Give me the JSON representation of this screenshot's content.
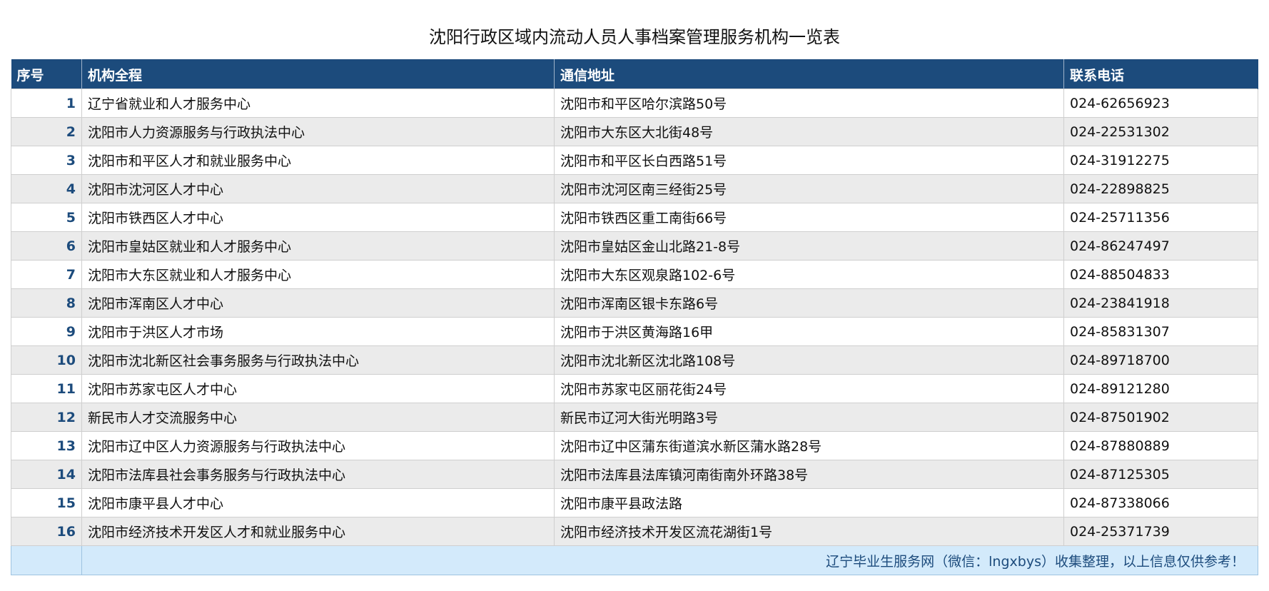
{
  "title": "沈阳行政区域内流动人员人事档案管理服务机构一览表",
  "table": {
    "headers": [
      "序号",
      "机构全程",
      "通信地址",
      "联系电话"
    ],
    "rows": [
      {
        "no": "1",
        "name": "辽宁省就业和人才服务中心",
        "address": "沈阳市和平区哈尔滨路50号",
        "phone": "024-62656923"
      },
      {
        "no": "2",
        "name": "沈阳市人力资源服务与行政执法中心",
        "address": "沈阳市大东区大北街48号",
        "phone": "024-22531302"
      },
      {
        "no": "3",
        "name": "沈阳市和平区人才和就业服务中心",
        "address": "沈阳市和平区长白西路51号",
        "phone": "024-31912275"
      },
      {
        "no": "4",
        "name": "沈阳市沈河区人才中心",
        "address": "沈阳市沈河区南三经街25号",
        "phone": "024-22898825"
      },
      {
        "no": "5",
        "name": "沈阳市铁西区人才中心",
        "address": "沈阳市铁西区重工南街66号",
        "phone": "024-25711356"
      },
      {
        "no": "6",
        "name": "沈阳市皇姑区就业和人才服务中心",
        "address": "沈阳市皇姑区金山北路21-8号",
        "phone": "024-86247497"
      },
      {
        "no": "7",
        "name": "沈阳市大东区就业和人才服务中心",
        "address": "沈阳市大东区观泉路102-6号",
        "phone": "024-88504833"
      },
      {
        "no": "8",
        "name": "沈阳市浑南区人才中心",
        "address": "沈阳市浑南区银卡东路6号",
        "phone": "024-23841918"
      },
      {
        "no": "9",
        "name": "沈阳市于洪区人才市场",
        "address": "沈阳市于洪区黄海路16甲",
        "phone": "024-85831307"
      },
      {
        "no": "10",
        "name": "沈阳市沈北新区社会事务服务与行政执法中心",
        "address": "沈阳市沈北新区沈北路108号",
        "phone": "024-89718700"
      },
      {
        "no": "11",
        "name": "沈阳市苏家屯区人才中心",
        "address": "沈阳市苏家屯区丽花街24号",
        "phone": "024-89121280"
      },
      {
        "no": "12",
        "name": "新民市人才交流服务中心",
        "address": "新民市辽河大街光明路3号",
        "phone": "024-87501902"
      },
      {
        "no": "13",
        "name": "沈阳市辽中区人力资源服务与行政执法中心",
        "address": "沈阳市辽中区蒲东街道滨水新区蒲水路28号",
        "phone": "024-87880889"
      },
      {
        "no": "14",
        "name": "沈阳市法库县社会事务服务与行政执法中心",
        "address": "沈阳市法库县法库镇河南街南外环路38号",
        "phone": "024-87125305"
      },
      {
        "no": "15",
        "name": "沈阳市康平县人才中心",
        "address": "沈阳市康平县政法路",
        "phone": "024-87338066"
      },
      {
        "no": "16",
        "name": "沈阳市经济技术开发区人才和就业服务中心",
        "address": "沈阳市经济技术开发区流花湖街1号",
        "phone": "024-25371739"
      }
    ],
    "footer": "辽宁毕业生服务网（微信：lngxbys）收集整理，以上信息仅供参考！"
  },
  "colors": {
    "header_bg": "#1c4b7c",
    "row_alt_bg": "#ebebeb",
    "footer_bg": "#d3eafb",
    "index_text": "#1c4b7c"
  }
}
